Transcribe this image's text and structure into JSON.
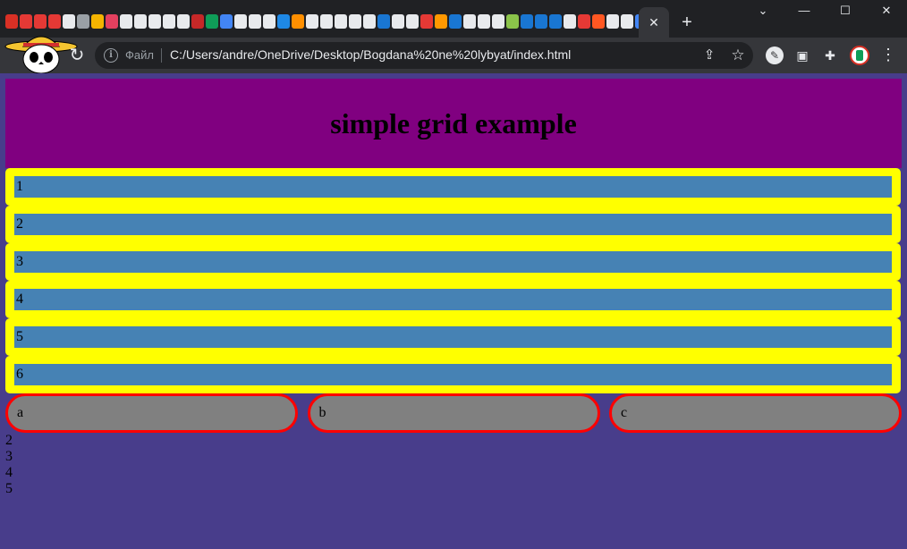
{
  "browser": {
    "tab_close_glyph": "✕",
    "new_tab_glyph": "+",
    "window_controls": {
      "minimize": "—",
      "maximize": "☐",
      "close": "✕"
    },
    "reload_glyph": "↻",
    "address_bar": {
      "scheme_label": "Файл",
      "url": "C:/Users/andre/OneDrive/Desktop/Bogdana%20ne%20lybyat/index.html"
    },
    "tab_favicon_colors": [
      "#d93025",
      "#e53935",
      "#e53935",
      "#e53935",
      "#e8eaed",
      "#9aa0a6",
      "#f4b400",
      "#e4405f",
      "#e8eaed",
      "#e8eaed",
      "#e8eaed",
      "#e8eaed",
      "#e8eaed",
      "#c62828",
      "#0f9d58",
      "#4285f4",
      "#e8eaed",
      "#e8eaed",
      "#e8eaed",
      "#1e88e5",
      "#ff8f00",
      "#e8eaed",
      "#e8eaed",
      "#e8eaed",
      "#e8eaed",
      "#e8eaed",
      "#1976d2",
      "#e8eaed",
      "#e8eaed",
      "#e53935",
      "#ff9800",
      "#1976d2",
      "#e8eaed",
      "#e8eaed",
      "#e8eaed",
      "#8bc34a",
      "#1976d2",
      "#1976d2",
      "#1976d2",
      "#e8eaed",
      "#e53935",
      "#ff5722",
      "#e8eaed",
      "#e8eaed",
      "#4285f4",
      "#e8eaed"
    ]
  },
  "page": {
    "title": "simple grid example",
    "rows": [
      "1",
      "2",
      "3",
      "4",
      "5",
      "6"
    ],
    "cells": [
      "a",
      "b",
      "c"
    ],
    "overflow_items": [
      "2",
      "3",
      "4",
      "5"
    ]
  },
  "colors": {
    "page_background": "#483d8b",
    "header_background": "#800080",
    "row_outer": "#ffff00",
    "row_inner": "#4682b4",
    "cell_background": "#808080",
    "cell_border": "#ff0000"
  }
}
